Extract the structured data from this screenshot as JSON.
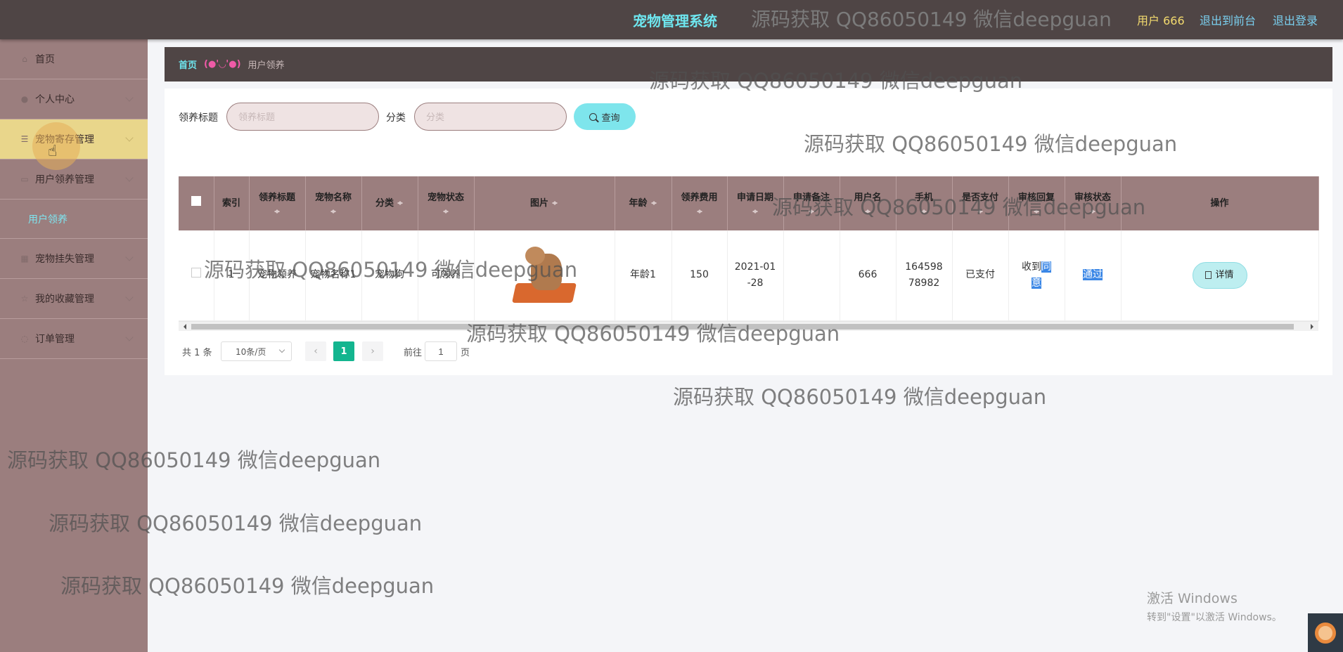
{
  "header": {
    "system_title": "宠物管理系统",
    "user": "用户 666",
    "back_to_front": "退出到前台",
    "logout": "退出登录"
  },
  "sidebar": {
    "items": [
      {
        "label": "首页",
        "icon": "home-icon"
      },
      {
        "label": "个人中心",
        "icon": "user-icon"
      },
      {
        "label": "宠物寄存管理",
        "icon": "menu-icon"
      },
      {
        "label": "用户领养管理",
        "icon": "folder-icon"
      },
      {
        "label": "宠物挂失管理",
        "icon": "grid-icon"
      },
      {
        "label": "我的收藏管理",
        "icon": "star-icon"
      },
      {
        "label": "订单管理",
        "icon": "order-icon"
      }
    ],
    "submenu_adopt": "用户领养"
  },
  "breadcrumb": {
    "home": "首页",
    "separator": "(●'◡'●)",
    "current": "用户领养"
  },
  "search": {
    "title_label": "领养标题",
    "title_placeholder": "领养标题",
    "category_label": "分类",
    "category_placeholder": "分类",
    "query_button": "查询"
  },
  "table": {
    "columns": [
      "索引",
      "领养标题",
      "宠物名称",
      "分类",
      "宠物状态",
      "图片",
      "年龄",
      "领养费用",
      "申请日期",
      "申请备注",
      "用户名",
      "手机",
      "是否支付",
      "审核回复",
      "审核状态",
      "操作"
    ],
    "rows": [
      {
        "index": "1",
        "title": "宠物领养",
        "pet_name": "宠物名称1",
        "category": "宠物狗",
        "status": "可领养",
        "age": "年龄1",
        "fee": "150",
        "date": "2021-01-28",
        "remark": "",
        "username": "666",
        "phone": "16459878982",
        "paid": "已支付",
        "reply_prefix": "收到",
        "reply_highlight": "同意",
        "audit_status": "通过",
        "detail_button": "详情"
      }
    ]
  },
  "pagination": {
    "total": "共 1 条",
    "page_size": "10条/页",
    "current_page": "1",
    "goto_label": "前往",
    "goto_value": "1",
    "page_unit": "页"
  },
  "watermark": "源码获取 QQ86050149 微信deepguan",
  "windows_activate": {
    "line1": "激活 Windows",
    "line2": "转到\"设置\"以激活 Windows。"
  },
  "colors": {
    "header_bg": "#4f4545",
    "sidebar_bg": "#9b7e7e",
    "accent_cyan": "#6ee6ef",
    "active_menu": "#e9d68b",
    "page_active": "#13b58f"
  }
}
